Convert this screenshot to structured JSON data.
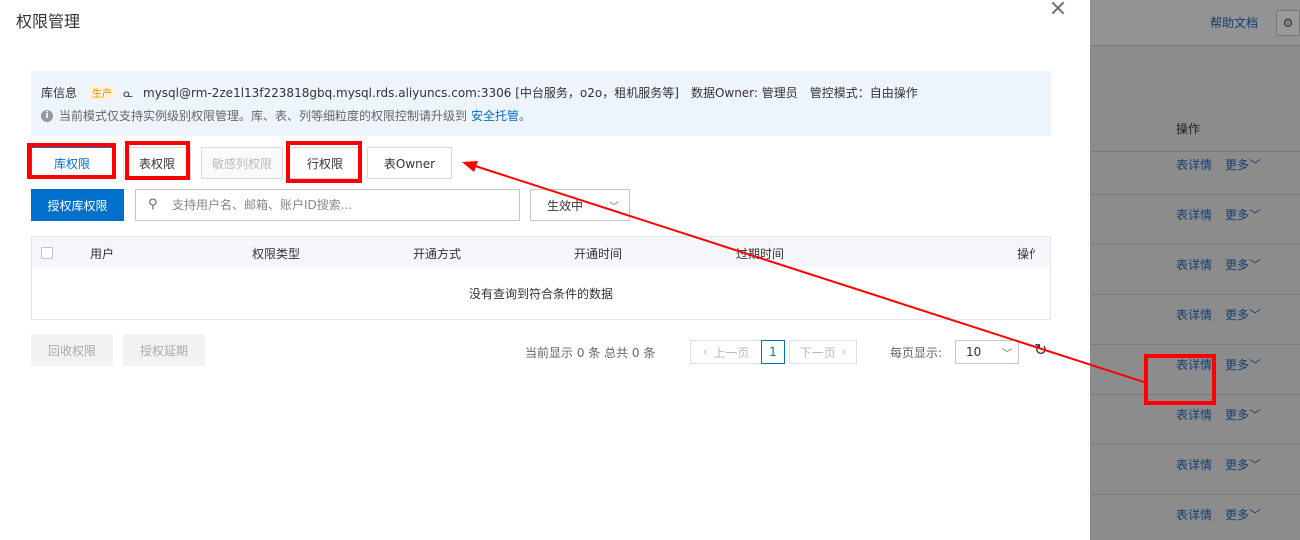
{
  "background": {
    "help_docs": "帮助文档",
    "op_header": "操作",
    "rows": [
      {
        "detail": "表详情",
        "more": "更多"
      },
      {
        "detail": "表详情",
        "more": "更多"
      },
      {
        "detail": "表详情",
        "more": "更多"
      },
      {
        "detail": "表详情",
        "more": "更多"
      },
      {
        "detail": "表详情",
        "more": "更多"
      },
      {
        "detail": "表详情",
        "more": "更多"
      },
      {
        "detail": "表详情",
        "more": "更多"
      },
      {
        "detail": "表详情",
        "more": "更多"
      }
    ]
  },
  "dialog": {
    "title": "权限管理",
    "info": {
      "label": "库信息",
      "env_tag": "生产",
      "instance": "mysql@rm-2ze1l13f223818gbq.mysql.rds.aliyuncs.com:3306 [中台服务，o2o，租机服务等]",
      "owner": "数据Owner: 管理员",
      "control_mode": "管控模式：自由操作",
      "notice": "当前模式仅支持实例级别权限管理。库、表、列等细粒度的权限控制请升级到",
      "notice_link": "安全托管",
      "notice_end": "。"
    },
    "tabs": [
      {
        "label": "库权限",
        "state": "active"
      },
      {
        "label": "表权限",
        "state": "normal"
      },
      {
        "label": "敏感列权限",
        "state": "disabled"
      },
      {
        "label": "行权限",
        "state": "normal"
      },
      {
        "label": "表Owner",
        "state": "normal"
      }
    ],
    "grant_button": "授权库权限",
    "search_placeholder": "支持用户名、邮箱、账户ID搜索...",
    "status_select": "生效中",
    "table": {
      "columns": [
        "用户",
        "权限类型",
        "开通方式",
        "开通时间",
        "过期时间",
        "操作"
      ],
      "empty_text": "没有查询到符合条件的数据"
    },
    "revoke_button": "回收权限",
    "extend_button": "授权延期",
    "pagination": {
      "info": "当前显示 0 条 总共 0 条",
      "prev": "上一页",
      "current_page": "1",
      "next": "下一页",
      "page_size_label": "每页显示:",
      "page_size": "10"
    }
  },
  "colors": {
    "accent": "#0070cc",
    "annotation": "#ff0000"
  }
}
